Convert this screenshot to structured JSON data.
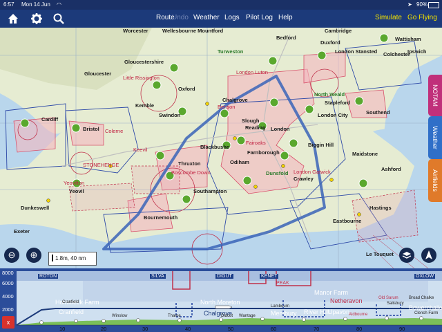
{
  "status_bar": {
    "time": "6:57",
    "date": "Mon 14 Jun",
    "battery": "90%"
  },
  "toolbar": {
    "items": [
      {
        "label": "Route",
        "state": "normal"
      },
      {
        "label": "Undo",
        "state": "disabled"
      },
      {
        "label": "Weather",
        "state": "normal"
      },
      {
        "label": "Logs",
        "state": "normal"
      },
      {
        "label": "Pilot Log",
        "state": "normal"
      },
      {
        "label": "Help",
        "state": "normal"
      }
    ],
    "right": {
      "simulate": "Simulate",
      "go_flying": "Go Flying"
    },
    "icons": [
      "home-icon",
      "gear-icon",
      "search-icon"
    ]
  },
  "side_tabs": [
    {
      "label": "NOTAM",
      "color": "#c0307a"
    },
    {
      "label": "Weather",
      "color": "#2f6fc8"
    },
    {
      "label": "Airfields",
      "color": "#e07a2a"
    }
  ],
  "map": {
    "scale": "1.8m, 40 nm",
    "route_color": "#3a64b8",
    "places": [
      {
        "name": "Worcester",
        "cls": "place"
      },
      {
        "name": "Wellesbourne Mountford",
        "cls": "place"
      },
      {
        "name": "Bedford",
        "cls": "place"
      },
      {
        "name": "Cambridge",
        "cls": "place"
      },
      {
        "name": "Turweston",
        "cls": "place-green"
      },
      {
        "name": "Duxford",
        "cls": "place"
      },
      {
        "name": "Wattisham",
        "cls": "place"
      },
      {
        "name": "Ipswich",
        "cls": "place"
      },
      {
        "name": "Gloucestershire",
        "cls": "place"
      },
      {
        "name": "Gloucester",
        "cls": "place"
      },
      {
        "name": "Little Rissington",
        "cls": "place-red"
      },
      {
        "name": "Oxford",
        "cls": "place"
      },
      {
        "name": "Kemble",
        "cls": "place"
      },
      {
        "name": "Swindon",
        "cls": "place"
      },
      {
        "name": "London Luton",
        "cls": "place-red"
      },
      {
        "name": "London Stansted",
        "cls": "place"
      },
      {
        "name": "Colchester",
        "cls": "place"
      },
      {
        "name": "North Weald",
        "cls": "place-green"
      },
      {
        "name": "Stapleford",
        "cls": "place"
      },
      {
        "name": "Southend",
        "cls": "place"
      },
      {
        "name": "London City",
        "cls": "place"
      },
      {
        "name": "Chalgrove",
        "cls": "place"
      },
      {
        "name": "Benson",
        "cls": "place-red"
      },
      {
        "name": "Reading",
        "cls": "place"
      },
      {
        "name": "London",
        "cls": "place"
      },
      {
        "name": "Cardiff",
        "cls": "place"
      },
      {
        "name": "Bristol",
        "cls": "place"
      },
      {
        "name": "Colerne",
        "cls": "place-red"
      },
      {
        "name": "Keevil",
        "cls": "place-red"
      },
      {
        "name": "Fairoaks",
        "cls": "place-red"
      },
      {
        "name": "Blackbushe",
        "cls": "place"
      },
      {
        "name": "Farnborough",
        "cls": "place"
      },
      {
        "name": "Odiham",
        "cls": "place"
      },
      {
        "name": "Biggin Hill",
        "cls": "place"
      },
      {
        "name": "Maidstone",
        "cls": "place"
      },
      {
        "name": "Slough",
        "cls": "place"
      },
      {
        "name": "STONEHENGE",
        "cls": "place-red"
      },
      {
        "name": "Thruxton",
        "cls": "place"
      },
      {
        "name": "Boscombe Down",
        "cls": "place-red"
      },
      {
        "name": "Dunsfold",
        "cls": "place-green"
      },
      {
        "name": "London Gatwick",
        "cls": "place-red"
      },
      {
        "name": "Crawley",
        "cls": "place"
      },
      {
        "name": "Ashford",
        "cls": "place"
      },
      {
        "name": "Yeovilton",
        "cls": "place-red"
      },
      {
        "name": "Yeovil",
        "cls": "place"
      },
      {
        "name": "Southampton",
        "cls": "place"
      },
      {
        "name": "Hastings",
        "cls": "place"
      },
      {
        "name": "Dunkeswell",
        "cls": "place"
      },
      {
        "name": "Bournemouth",
        "cls": "place"
      },
      {
        "name": "Eastbourne",
        "cls": "place"
      },
      {
        "name": "Exeter",
        "cls": "place"
      },
      {
        "name": "Le Touquet",
        "cls": "place"
      }
    ]
  },
  "profile": {
    "altitudes": [
      "8000",
      "6000",
      "4000",
      "2000",
      "0"
    ],
    "waypoints": [
      "ROTON",
      "SILVA",
      "DIGUT",
      "KENET",
      "PEAK",
      "OXLOW"
    ],
    "distances": [
      "10",
      "20",
      "30",
      "40",
      "50",
      "60",
      "70",
      "80",
      "90"
    ],
    "places": [
      "Holmbeck Farm",
      "Cranfield",
      "North Moreton",
      "Manor Farm",
      "Netheravon",
      "Cranfield",
      "Winslow",
      "Thame",
      "Chalgrove",
      "Didcot",
      "Wantage",
      "Lambourn",
      "Membury",
      "River Hill",
      "Upavon",
      "Salisbury",
      "Bowerchalke",
      "Old Sarum",
      "Broad Chalke",
      "Clench Farm",
      "Aldbourne"
    ],
    "close_label": "x"
  }
}
